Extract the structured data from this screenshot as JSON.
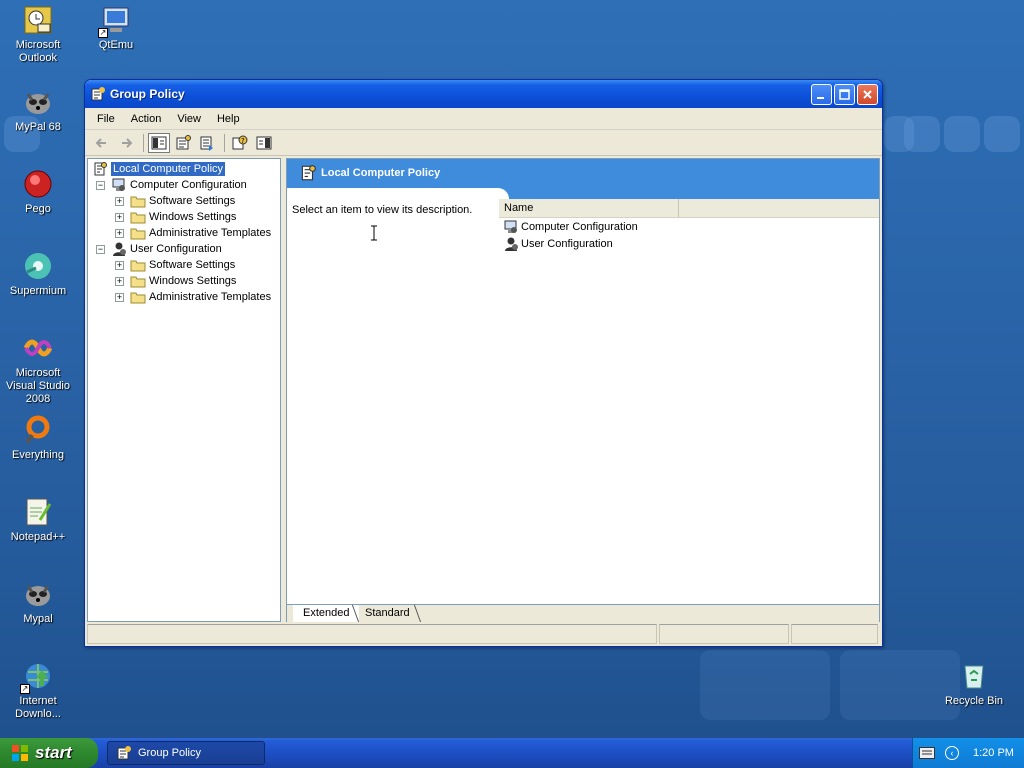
{
  "desktop": {
    "icons": [
      {
        "label": "Microsoft Outlook",
        "icon": "outlook-icon"
      },
      {
        "label": "QtEmu",
        "icon": "qtemu-icon"
      },
      {
        "label": "MyPal 68",
        "icon": "mypal-icon"
      },
      {
        "label": "Pego",
        "icon": "pego-icon"
      },
      {
        "label": "Supermium",
        "icon": "supermium-icon"
      },
      {
        "label": "Microsoft Visual Studio 2008",
        "icon": "visual-studio-icon"
      },
      {
        "label": "Everything",
        "icon": "everything-icon"
      },
      {
        "label": "Notepad++",
        "icon": "notepad-plus-plus-icon"
      },
      {
        "label": "Mypal",
        "icon": "mypal-icon"
      },
      {
        "label": "Internet Downlo...",
        "icon": "internet-download-icon"
      },
      {
        "label": "Recycle Bin",
        "icon": "recycle-bin-icon"
      }
    ]
  },
  "window": {
    "title": "Group Policy",
    "menu": [
      "File",
      "Action",
      "View",
      "Help"
    ],
    "tree": {
      "root": "Local Computer Policy",
      "computer": "Computer Configuration",
      "user": "User Configuration",
      "children": [
        "Software Settings",
        "Windows Settings",
        "Administrative Templates"
      ]
    },
    "right": {
      "header_title": "Local Computer Policy",
      "description": "Select an item to view its description.",
      "column_name": "Name",
      "items": [
        "Computer Configuration",
        "User Configuration"
      ]
    },
    "tabs": [
      "Extended",
      "Standard"
    ]
  },
  "taskbar": {
    "start_label": "start",
    "task_label": "Group Policy",
    "clock": "1:20 PM"
  },
  "colors": {
    "titlebar": "#0c50d8",
    "selection": "#316ac5",
    "header_band": "#3f8cdd",
    "start_green": "#2f8a2f"
  }
}
